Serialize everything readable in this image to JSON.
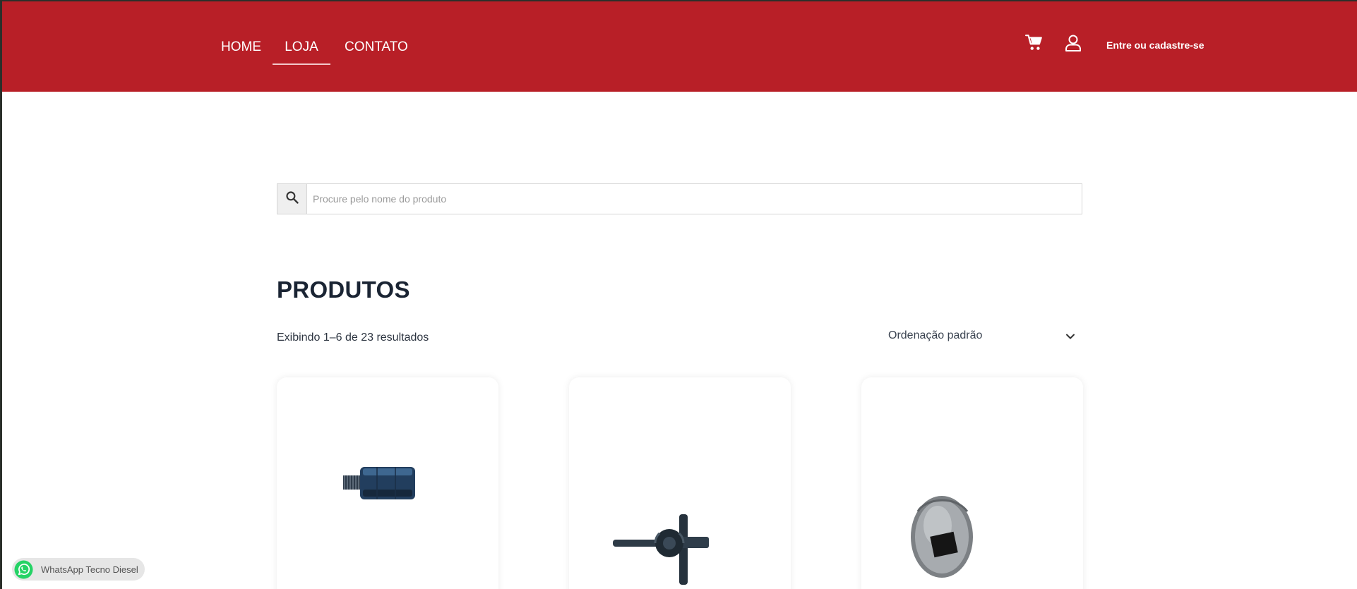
{
  "header": {
    "nav": [
      {
        "label": "HOME"
      },
      {
        "label": "LOJA"
      },
      {
        "label": "CONTATO"
      }
    ],
    "active_nav": "LOJA",
    "login_label": "Entre ou cadastre-se",
    "background_color": "#b81f27"
  },
  "search": {
    "placeholder": "Procure pelo nome do produto",
    "value": ""
  },
  "main": {
    "title": "PRODUTOS",
    "result_count": "Exibindo 1–6 de 23 resultados",
    "sort": {
      "selected": "Ordenação padrão"
    }
  },
  "products": [
    {
      "image": "hex-adapter-fitting-image"
    },
    {
      "image": "cross-wrench-tool-image"
    },
    {
      "image": "socket-square-drive-image"
    }
  ],
  "whatsapp": {
    "label": "WhatsApp Tecno Diesel",
    "color": "#25d366"
  }
}
